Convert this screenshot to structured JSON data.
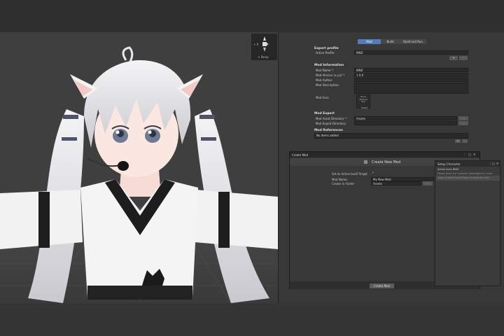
{
  "gizmo": {
    "x_label": "< X",
    "persp_label": "< Persp"
  },
  "inspector": {
    "tabs": [
      {
        "label": "Mod",
        "active": true
      },
      {
        "label": "Build",
        "active": false
      },
      {
        "label": "Build and Run",
        "active": false
      }
    ],
    "export_profile": {
      "header": "Export profile",
      "active_profile_label": "Active Profile:",
      "active_profile_value": "BINZ",
      "add_btn": "+",
      "remove_btn": "-"
    },
    "mod_info": {
      "header": "Mod Information",
      "name_label": "Mod Name *:",
      "name_value": "BINZ",
      "version_label": "Mod Version (x.y.z) *:",
      "version_value": "1.0.0",
      "author_label": "Mod Author:",
      "author_value": "",
      "description_label": "Mod Description:",
      "description_value": "",
      "icon_label": "Mod Icon:",
      "icon_text": "None\n(Texture\n2D)",
      "icon_select": "Select"
    },
    "mod_export": {
      "header": "Mod Export",
      "asset_dir_label": "Mod Asset Directory *:",
      "asset_dir_value": "Assets",
      "export_dir_label": "Mod Export Directory:",
      "export_dir_value": "",
      "browse_btn": "..."
    },
    "mod_refs": {
      "header": "Mod References",
      "empty_text": "No items added",
      "add_btn": "+",
      "remove_btn": "-"
    }
  },
  "create_window": {
    "tab_title": "Create Mod",
    "heading": "Create New Mod",
    "set_active_label": "Set as Active build Target",
    "set_active_checked": "✓",
    "mod_name_label": "Mod Name:",
    "mod_name_value": "My New Mod",
    "folder_label": "Create in Folder:",
    "folder_value": "Assets",
    "browse_btn": "...",
    "create_btn": "Create Mod"
  },
  "setup_window": {
    "title": "Setup Character",
    "active_mod": "Active mod: BINZ",
    "hint": "Please select the character GameObject in scene",
    "button": "Setup selected GameObject as character mod"
  }
}
